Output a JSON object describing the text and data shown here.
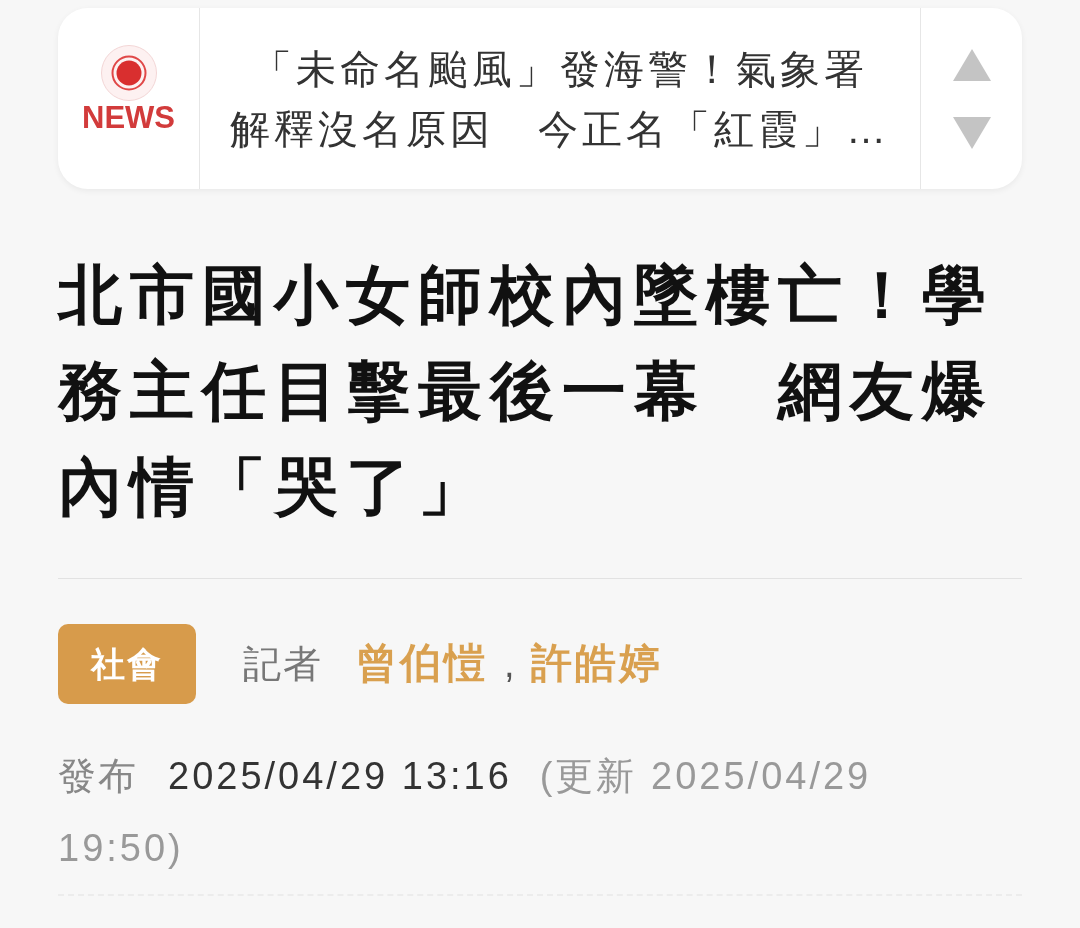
{
  "ticker": {
    "logo_label": "NEWS",
    "headline_lines": [
      "「未命名颱風」發海警！氣象署",
      "解釋沒名原因　今正名「紅霞」…"
    ]
  },
  "article": {
    "title": "北市國小女師校內墜樓亡！學務主任目擊最後一幕　網友爆內情「哭了」",
    "category": "社會",
    "byline_label": "記者",
    "authors": [
      "曾伯愷",
      "許皓婷"
    ],
    "author_separator": ",",
    "published_label": "發布",
    "published_time": "2025/04/29 13:16",
    "updated": "(更新 2025/04/29 19:50)"
  }
}
